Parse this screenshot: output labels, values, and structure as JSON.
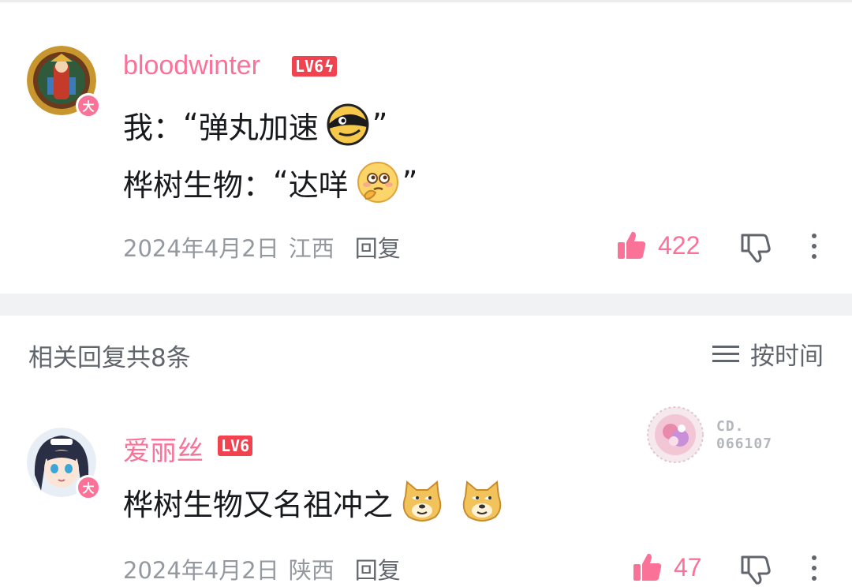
{
  "comment1": {
    "username": "bloodwinter",
    "level": "LV6",
    "badge_char": "大",
    "line1_prefix": "我：",
    "line1_quote_open": "“",
    "line1_text": "弹丸加速",
    "line1_quote_close": "”",
    "line1_emoji": "doge-black-emoji",
    "line2_prefix": "桦树生物：",
    "line2_quote_open": "“",
    "line2_text": "达咩",
    "line2_quote_close": "”",
    "line2_emoji": "thinking-emoji",
    "date": "2024年4月2日",
    "region": "江西",
    "reply_label": "回复",
    "likes": "422"
  },
  "replies_header": {
    "title": "相关回复共8条",
    "sort_label": "按时间",
    "sort_icon": "menu-icon"
  },
  "comment2": {
    "username": "爱丽丝",
    "level": "LV6",
    "badge_char": "大",
    "text": "桦树生物又名祖冲之",
    "emoji": "doge-emoji",
    "decoration_code_line1": "CD.",
    "decoration_code_line2": "066107",
    "date": "2024年4月2日",
    "region": "陕西",
    "reply_label": "回复",
    "likes": "47"
  },
  "colors": {
    "accent": "#fb7299",
    "level_badge": "#f0424f",
    "meta_text": "#9499a0",
    "divider": "#f1f2f3"
  }
}
